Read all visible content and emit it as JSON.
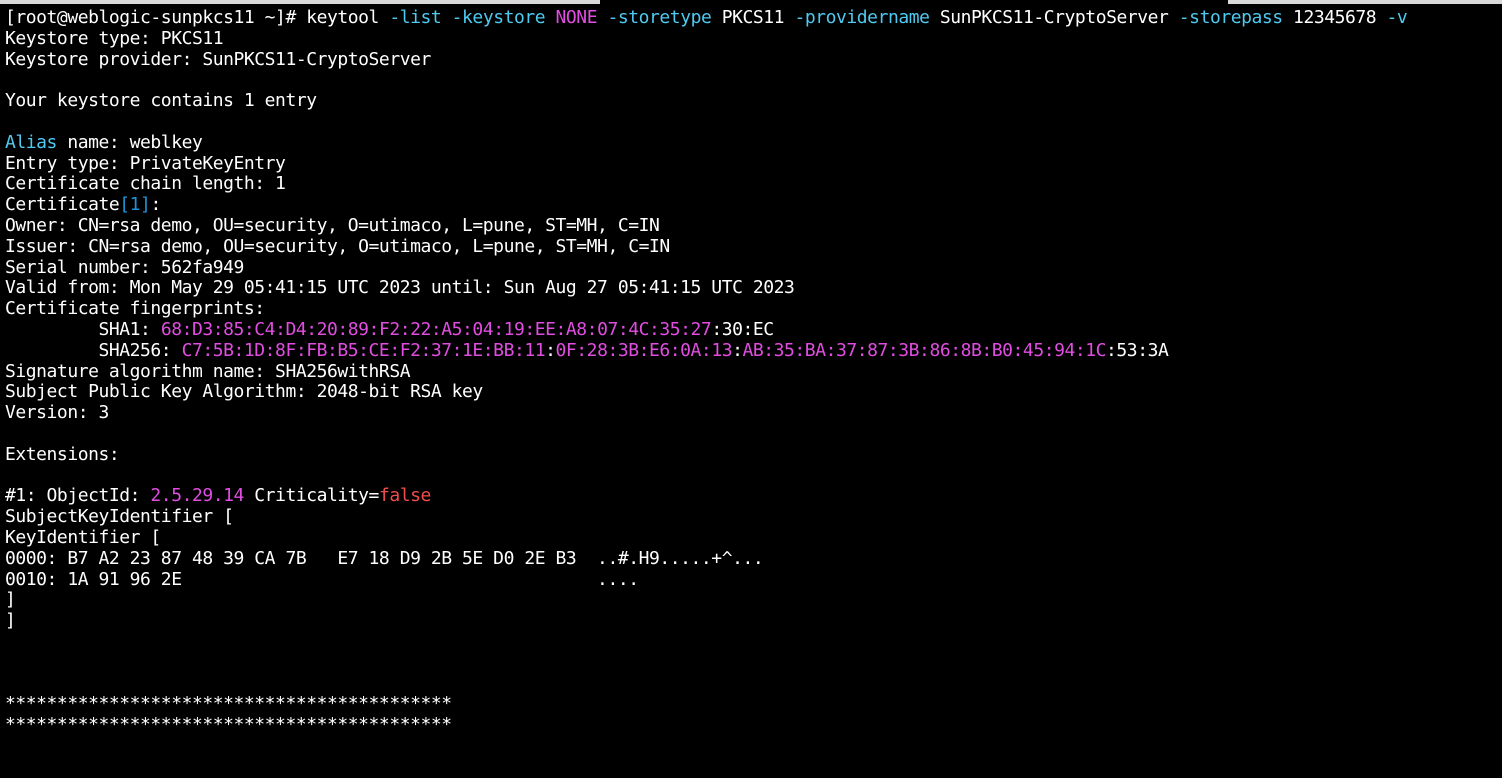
{
  "colors": {
    "background": "#000000",
    "foreground": "#ffffff",
    "cyan": "#4ec9f0",
    "magenta": "#e14de1",
    "bracket": "#1f93d6",
    "red": "#f14c4c"
  },
  "terminal": {
    "lines": [
      {
        "segments": [
          {
            "text": "[root@weblogic-sunpkcs11 ~]# keytool ",
            "color": "#ffffff"
          },
          {
            "text": "-list",
            "color": "#4ec9f0"
          },
          {
            "text": " ",
            "color": "#ffffff"
          },
          {
            "text": "-keystore",
            "color": "#4ec9f0"
          },
          {
            "text": " ",
            "color": "#ffffff"
          },
          {
            "text": "NONE",
            "color": "#e14de1"
          },
          {
            "text": " ",
            "color": "#ffffff"
          },
          {
            "text": "-storetype",
            "color": "#4ec9f0"
          },
          {
            "text": " PKCS11 ",
            "color": "#ffffff"
          },
          {
            "text": "-providername",
            "color": "#4ec9f0"
          },
          {
            "text": " SunPKCS11-CryptoServer ",
            "color": "#ffffff"
          },
          {
            "text": "-storepass",
            "color": "#4ec9f0"
          },
          {
            "text": " 12345678 ",
            "color": "#ffffff"
          },
          {
            "text": "-v",
            "color": "#4ec9f0"
          }
        ]
      },
      {
        "segments": [
          {
            "text": "Keystore type: PKCS11",
            "color": "#ffffff"
          }
        ]
      },
      {
        "segments": [
          {
            "text": "Keystore provider: SunPKCS11-CryptoServer",
            "color": "#ffffff"
          }
        ]
      },
      {
        "segments": [
          {
            "text": "",
            "color": "#ffffff"
          }
        ]
      },
      {
        "segments": [
          {
            "text": "Your keystore contains 1 entry",
            "color": "#ffffff"
          }
        ]
      },
      {
        "segments": [
          {
            "text": "",
            "color": "#ffffff"
          }
        ]
      },
      {
        "segments": [
          {
            "text": "Alias",
            "color": "#4ec9f0"
          },
          {
            "text": " name: weblkey",
            "color": "#ffffff"
          }
        ]
      },
      {
        "segments": [
          {
            "text": "Entry type: PrivateKeyEntry",
            "color": "#ffffff"
          }
        ]
      },
      {
        "segments": [
          {
            "text": "Certificate chain length: 1",
            "color": "#ffffff"
          }
        ]
      },
      {
        "segments": [
          {
            "text": "Certificate",
            "color": "#ffffff"
          },
          {
            "text": "[1]",
            "color": "#1f93d6"
          },
          {
            "text": ":",
            "color": "#ffffff"
          }
        ]
      },
      {
        "segments": [
          {
            "text": "Owner: CN=rsa demo, OU=security, O=utimaco, L=pune, ST=MH, C=IN",
            "color": "#ffffff"
          }
        ]
      },
      {
        "segments": [
          {
            "text": "Issuer: CN=rsa demo, OU=security, O=utimaco, L=pune, ST=MH, C=IN",
            "color": "#ffffff"
          }
        ]
      },
      {
        "segments": [
          {
            "text": "Serial number: 562fa949",
            "color": "#ffffff"
          }
        ]
      },
      {
        "segments": [
          {
            "text": "Valid from: Mon May 29 05:41:15 UTC 2023 until: Sun Aug 27 05:41:15 UTC 2023",
            "color": "#ffffff"
          }
        ]
      },
      {
        "segments": [
          {
            "text": "Certificate fingerprints:",
            "color": "#ffffff"
          }
        ]
      },
      {
        "segments": [
          {
            "text": "         SHA1: ",
            "color": "#ffffff"
          },
          {
            "text": "68:D3:85:C4:D4:20:89:F2:22:A5:04:19:EE:A8:07:4C:35:27",
            "color": "#e14de1"
          },
          {
            "text": ":30:EC",
            "color": "#ffffff"
          }
        ]
      },
      {
        "segments": [
          {
            "text": "         SHA256: ",
            "color": "#ffffff"
          },
          {
            "text": "C7:5B:1D:8F:FB:B5:CE:F2:37:1E:BB:11",
            "color": "#e14de1"
          },
          {
            "text": ":",
            "color": "#ffffff"
          },
          {
            "text": "0F:28:3B:E6:0A:13",
            "color": "#e14de1"
          },
          {
            "text": ":",
            "color": "#ffffff"
          },
          {
            "text": "AB:35:BA:37:87:3B:86:8B:B0:45:94:1C",
            "color": "#e14de1"
          },
          {
            "text": ":53:3A",
            "color": "#ffffff"
          }
        ]
      },
      {
        "segments": [
          {
            "text": "Signature algorithm name: SHA256withRSA",
            "color": "#ffffff"
          }
        ]
      },
      {
        "segments": [
          {
            "text": "Subject Public Key Algorithm: 2048-bit RSA key",
            "color": "#ffffff"
          }
        ]
      },
      {
        "segments": [
          {
            "text": "Version: 3",
            "color": "#ffffff"
          }
        ]
      },
      {
        "segments": [
          {
            "text": "",
            "color": "#ffffff"
          }
        ]
      },
      {
        "segments": [
          {
            "text": "Extensions:",
            "color": "#ffffff"
          }
        ]
      },
      {
        "segments": [
          {
            "text": "",
            "color": "#ffffff"
          }
        ]
      },
      {
        "segments": [
          {
            "text": "#1: ObjectId: ",
            "color": "#ffffff"
          },
          {
            "text": "2.5.29.14",
            "color": "#e14de1"
          },
          {
            "text": " Criticality=",
            "color": "#ffffff"
          },
          {
            "text": "false",
            "color": "#f14c4c"
          }
        ]
      },
      {
        "segments": [
          {
            "text": "SubjectKeyIdentifier [",
            "color": "#ffffff"
          }
        ]
      },
      {
        "segments": [
          {
            "text": "KeyIdentifier [",
            "color": "#ffffff"
          }
        ]
      },
      {
        "segments": [
          {
            "text": "0000: B7 A2 23 87 48 39 CA 7B   E7 18 D9 2B 5E D0 2E B3  ..#.H9.....+^...",
            "color": "#ffffff"
          }
        ]
      },
      {
        "segments": [
          {
            "text": "0010: 1A 91 96 2E                                        ....",
            "color": "#ffffff"
          }
        ]
      },
      {
        "segments": [
          {
            "text": "]",
            "color": "#ffffff"
          }
        ]
      },
      {
        "segments": [
          {
            "text": "]",
            "color": "#ffffff"
          }
        ]
      },
      {
        "segments": [
          {
            "text": "",
            "color": "#ffffff"
          }
        ]
      },
      {
        "segments": [
          {
            "text": "",
            "color": "#ffffff"
          }
        ]
      },
      {
        "segments": [
          {
            "text": "",
            "color": "#ffffff"
          }
        ]
      },
      {
        "segments": [
          {
            "text": "*******************************************",
            "color": "#ffffff"
          }
        ]
      },
      {
        "segments": [
          {
            "text": "*******************************************",
            "color": "#ffffff"
          }
        ]
      }
    ]
  }
}
